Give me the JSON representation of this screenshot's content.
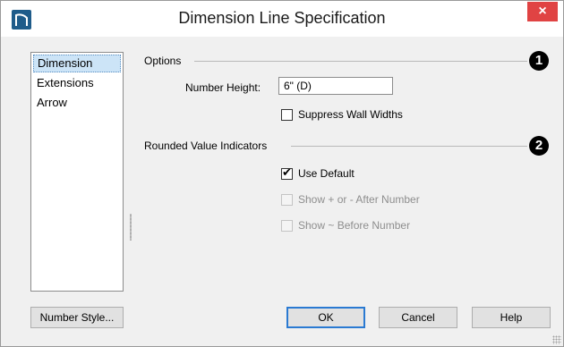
{
  "window": {
    "title": "Dimension Line Specification",
    "close_label": "×"
  },
  "sidebar": {
    "items": [
      {
        "label": "Dimension",
        "selected": true
      },
      {
        "label": "Extensions",
        "selected": false
      },
      {
        "label": "Arrow",
        "selected": false
      }
    ]
  },
  "options": {
    "heading": "Options",
    "badge": "1",
    "number_height_label": "Number Height:",
    "number_height_value": "6\" (D)",
    "suppress_wall_widths_label": "Suppress Wall Widths",
    "suppress_wall_widths_checked": false
  },
  "rounded": {
    "heading": "Rounded Value Indicators",
    "badge": "2",
    "use_default_label": "Use Default",
    "use_default_checked": true,
    "show_plus_minus_label": "Show + or - After Number",
    "show_tilde_label": "Show ~ Before Number"
  },
  "buttons": {
    "number_style": "Number Style...",
    "ok": "OK",
    "cancel": "Cancel",
    "help": "Help"
  },
  "colors": {
    "close_button": "#e04343",
    "selection": "#cce4f7",
    "default_button_border": "#2a7ad2"
  }
}
